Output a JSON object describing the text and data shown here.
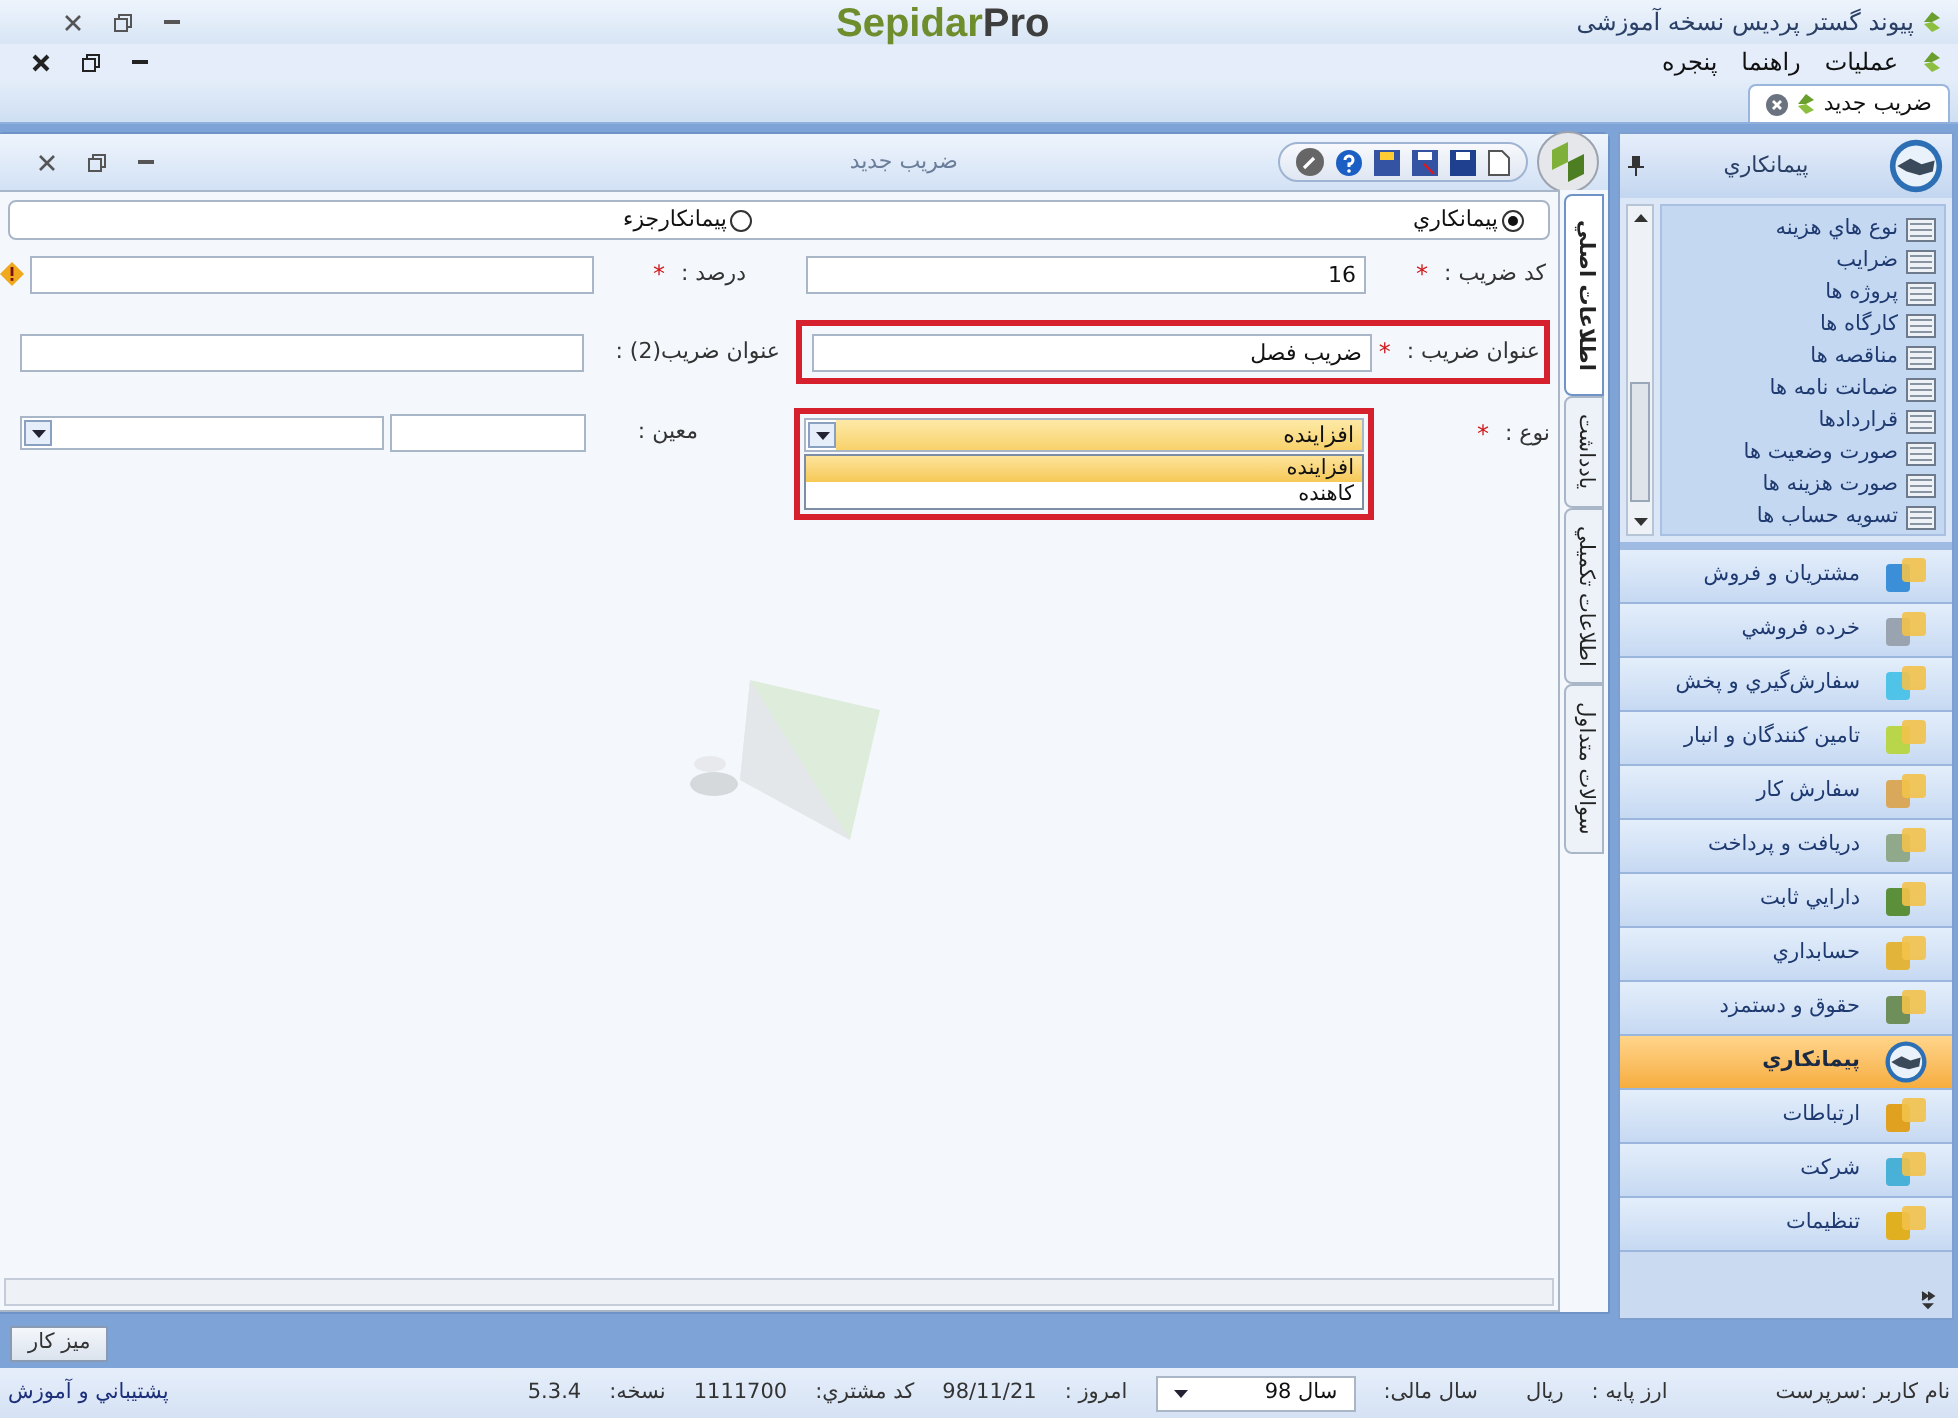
{
  "title_bar": {
    "title": "پیوند گستر پردیس نسخه آموزشی",
    "logo_main": "Sepidar",
    "logo_suffix": "Pro"
  },
  "menu": [
    "عمليات",
    "راهنما",
    "پنجره"
  ],
  "doc_tabs": [
    {
      "label": "ضریب جدید",
      "selected": true
    }
  ],
  "form_window": {
    "title": "ضريب جديد",
    "side_tabs": [
      {
        "label": "اطلاعات اصلي",
        "selected": true
      },
      {
        "label": "يادداشت",
        "selected": false
      },
      {
        "label": "اطلاعات تكميلي",
        "selected": false
      },
      {
        "label": "سوالات متداول",
        "selected": false
      }
    ],
    "radios": [
      {
        "label": "پيمانكاري",
        "selected": true
      },
      {
        "label": "پيمانكارجزء",
        "selected": false
      }
    ],
    "fields": {
      "code": {
        "label": "کد ضریب :",
        "mark": "*",
        "value": "16"
      },
      "percent": {
        "label": "درصد :",
        "mark": "*"
      },
      "title": {
        "label": "عنوان ضریب :",
        "mark": "*",
        "value": "ضريب فصل",
        "highlighted": true
      },
      "title2": {
        "label": "عنوان ضریب(2) :"
      },
      "type": {
        "label": "نوع :",
        "mark": "*",
        "value": "افزاينده",
        "highlighted": true,
        "options": [
          {
            "label": "افزاينده",
            "selected": true
          },
          {
            "label": "كاهنده",
            "selected": false
          }
        ]
      },
      "moein": {
        "label": "معین :"
      }
    }
  },
  "sidebar": {
    "title": "پيمانكاري",
    "items": [
      "نوع هاي هزينه",
      "ضرايب",
      "پروژه ها",
      "كارگاه ها",
      "مناقصه ها",
      "ضمانت نامه ها",
      "قراردادها",
      "صورت وضعيت ها",
      "صورت هزينه ها",
      "تسويه حساب ها"
    ],
    "modules": [
      {
        "label": "مشتريان و فروش",
        "selected": false
      },
      {
        "label": "خرده فروشي",
        "selected": false
      },
      {
        "label": "سفارش‌گيري و پخش",
        "selected": false
      },
      {
        "label": "تامين كنندگان و انبار",
        "selected": false
      },
      {
        "label": "سفارش كار",
        "selected": false
      },
      {
        "label": "دريافت و پرداخت",
        "selected": false
      },
      {
        "label": "دارايي ثابت",
        "selected": false
      },
      {
        "label": "حسابداري",
        "selected": false
      },
      {
        "label": "حقوق و دستمزد",
        "selected": false
      },
      {
        "label": "پيمانكاري",
        "selected": true
      },
      {
        "label": "ارتباطات",
        "selected": false
      },
      {
        "label": "شركت",
        "selected": false
      },
      {
        "label": "تنظيمات",
        "selected": false
      }
    ]
  },
  "taskbar": [
    "میز کار"
  ],
  "status_bar": {
    "user": "نام کاربر :سرپرست",
    "currency_label": "ارز پایه :",
    "currency": "ریال",
    "year_label": "سال مالی:",
    "year": "سال 98",
    "today_label": "امروز :",
    "today": "98/11/21",
    "customer_label": "کد مشتري:",
    "customer": "1111700",
    "version_label": "نسخه:",
    "version": "5.3.4",
    "support": "پشتيباني و آموزش"
  }
}
